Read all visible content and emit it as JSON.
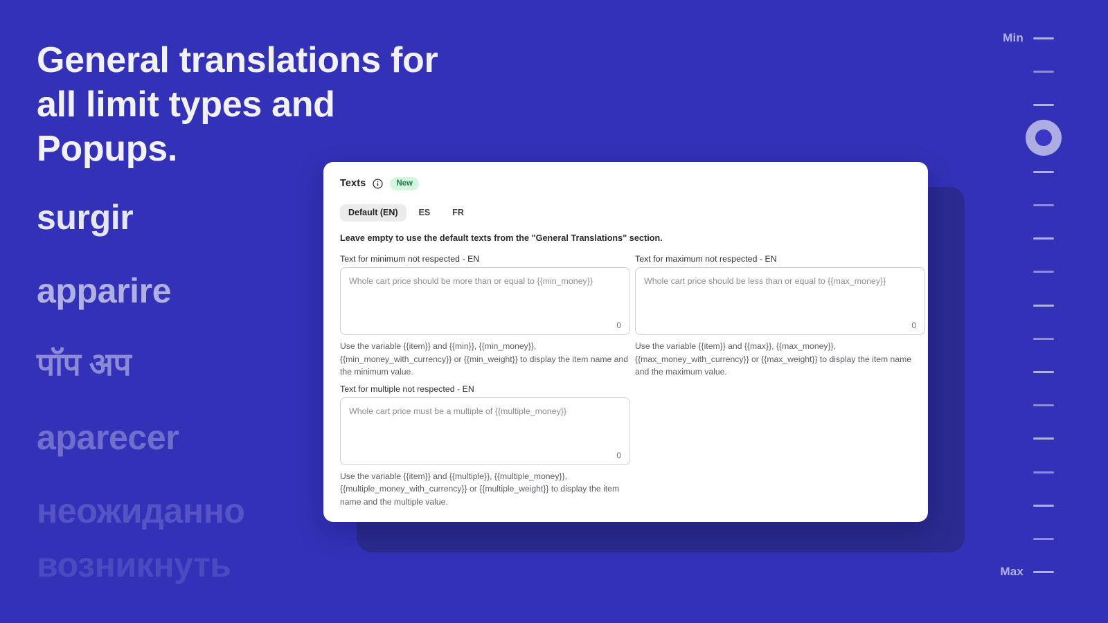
{
  "theme": {
    "background": "#3331b8",
    "back_panel": "#2b2a90",
    "card_background": "#ffffff",
    "badge_bg": "#d6f5e1",
    "badge_text": "#1e7a4d",
    "accent_text": "#f2f1f6"
  },
  "hero": {
    "title_lines": [
      "General translations for",
      "all limit types and",
      "Popups."
    ],
    "words": [
      "surgir",
      "apparire",
      "पॉप अप",
      "aparecer",
      "неожиданно",
      "возникнуть"
    ]
  },
  "card": {
    "title": "Texts",
    "info_icon": "info-circle-icon",
    "badge": "New",
    "tabs": [
      {
        "label": "Default (EN)",
        "active": true
      },
      {
        "label": "ES",
        "active": false
      },
      {
        "label": "FR",
        "active": false
      }
    ],
    "lead_note": "Leave empty to use the default texts from the \"General Translations\" section.",
    "fields": [
      {
        "label": "Text for minimum not respected - EN",
        "placeholder": "Whole cart price should be more than or equal to {{min_money}}",
        "value": "",
        "char_count": "0",
        "help": "Use the variable {{item}} and {{min}}, {{min_money}}, {{min_money_with_currency}} or {{min_weight}} to display the item name and the minimum value."
      },
      {
        "label": "Text for maximum not respected - EN",
        "placeholder": "Whole cart price should be less than or equal to {{max_money}}",
        "value": "",
        "char_count": "0",
        "help": "Use the variable {{item}} and {{max}}, {{max_money}}, {{max_money_with_currency}} or {{max_weight}} to display the item name and the maximum value."
      },
      {
        "label": "Text for multiple not respected - EN",
        "placeholder": "Whole cart price must be a multiple of {{multiple_money}}",
        "value": "",
        "char_count": "0",
        "help": "Use the variable {{item}} and {{multiple}}, {{multiple_money}}, {{multiple_money_with_currency}} or {{multiple_weight}} to display the item name and the multiple value."
      }
    ]
  },
  "slider": {
    "min_label": "Min",
    "max_label": "Max",
    "tick_count": 17,
    "thumb_index": 3,
    "thumb_icon": "slider-thumb-ring"
  }
}
